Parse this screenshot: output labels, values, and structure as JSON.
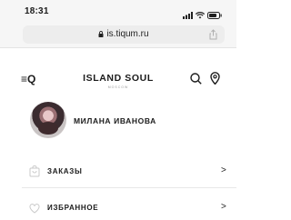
{
  "status_bar": {
    "time": "18:31",
    "icons": [
      "signal-icon",
      "wifi-icon",
      "battery-icon"
    ]
  },
  "browser": {
    "url": "is.tiqum.ru",
    "lock_icon": "lock-icon",
    "share_icon": "share-icon"
  },
  "header": {
    "menu_icon": "menu-search-icon",
    "menu_glyph": "≡Q",
    "logo_text": "ISLAND SOUL",
    "logo_sub": "MOSCOW",
    "search_icon": "search-icon",
    "location_icon": "location-pin-icon"
  },
  "profile": {
    "name": "МИЛАНА ИВАНОВА"
  },
  "menu": {
    "items": [
      {
        "label": "ЗАКАЗЫ",
        "icon": "bag-icon",
        "chevron": ">"
      },
      {
        "label": "ИЗБРАННОЕ",
        "icon": "heart-icon",
        "chevron": ">"
      }
    ]
  },
  "colors": {
    "chrome_bg": "#f6f6f6",
    "text": "#1b1b1b",
    "icon_muted": "#c9c9c9"
  }
}
